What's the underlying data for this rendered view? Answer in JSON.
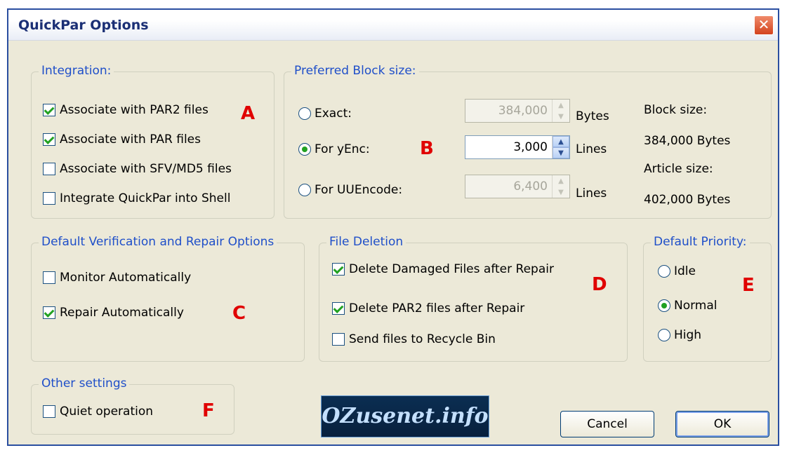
{
  "window": {
    "title": "QuickPar Options",
    "close_glyph": "✕"
  },
  "integration": {
    "legend": "Integration:",
    "items": [
      {
        "label": "Associate with PAR2 files",
        "checked": true
      },
      {
        "label": "Associate with PAR files",
        "checked": true
      },
      {
        "label": "Associate with SFV/MD5 files",
        "checked": false
      },
      {
        "label": "Integrate QuickPar into Shell",
        "checked": false
      }
    ],
    "marker": "A"
  },
  "block_size": {
    "legend": "Preferred Block size:",
    "options": [
      {
        "label": "Exact:",
        "selected": false,
        "value": "384,000",
        "unit": "Bytes",
        "enabled": false
      },
      {
        "label": "For yEnc:",
        "selected": true,
        "value": "3,000",
        "unit": "Lines",
        "enabled": true
      },
      {
        "label": "For UUEncode:",
        "selected": false,
        "value": "6,400",
        "unit": "Lines",
        "enabled": false
      }
    ],
    "block_size_label": "Block size:",
    "block_size_value": "384,000 Bytes",
    "article_size_label": "Article size:",
    "article_size_value": "402,000 Bytes",
    "marker": "B"
  },
  "verification": {
    "legend": "Default Verification and Repair Options",
    "items": [
      {
        "label": "Monitor Automatically",
        "checked": false
      },
      {
        "label": "Repair Automatically",
        "checked": true
      }
    ],
    "marker": "C"
  },
  "file_deletion": {
    "legend": "File Deletion",
    "items": [
      {
        "label": "Delete Damaged Files after Repair",
        "checked": true
      },
      {
        "label": "Delete PAR2 files after Repair",
        "checked": true
      },
      {
        "label": "Send files to Recycle Bin",
        "checked": false
      }
    ],
    "marker": "D"
  },
  "priority": {
    "legend": "Default Priority:",
    "options": [
      {
        "label": "Idle",
        "selected": false
      },
      {
        "label": "Normal",
        "selected": true
      },
      {
        "label": "High",
        "selected": false
      }
    ],
    "marker": "E"
  },
  "other": {
    "legend": "Other settings",
    "items": [
      {
        "label": "Quiet operation",
        "checked": false
      }
    ],
    "marker": "F"
  },
  "logo": {
    "text": "OZusenet.info"
  },
  "buttons": {
    "cancel": "Cancel",
    "ok": "OK"
  },
  "colors": {
    "accent": "#1f4fc9",
    "marker": "#e00000",
    "check": "#21a121",
    "dialog_bg": "#ece9d8"
  }
}
